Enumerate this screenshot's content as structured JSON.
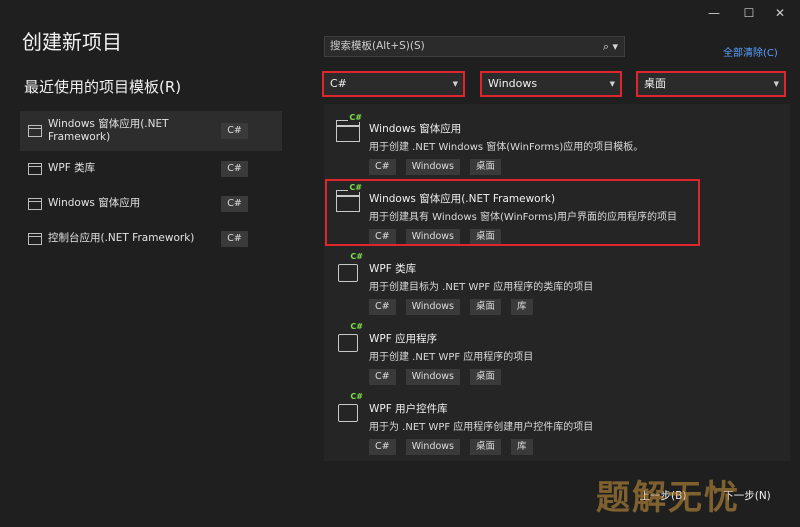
{
  "window": {
    "controls": [
      "—",
      "☐",
      "✕"
    ]
  },
  "page": {
    "title": "创建新项目",
    "recent_title": "最近使用的项目模板(R)"
  },
  "recent": [
    {
      "label": "Windows 窗体应用(.NET Framework)",
      "lang": "C#",
      "selected": true
    },
    {
      "label": "WPF 类库",
      "lang": "C#",
      "selected": false
    },
    {
      "label": "Windows 窗体应用",
      "lang": "C#",
      "selected": false
    },
    {
      "label": "控制台应用(.NET Framework)",
      "lang": "C#",
      "selected": false
    }
  ],
  "search": {
    "placeholder": "搜索模板(Alt+S)(S)",
    "icon": "search-icon"
  },
  "clear_all": "全部清除(C)",
  "filters": {
    "language": "C#",
    "platform": "Windows",
    "project_type": "桌面"
  },
  "templates": [
    {
      "title": "Windows 窗体应用",
      "desc": "用于创建 .NET Windows 窗体(WinForms)应用的项目模板。",
      "tags": [
        "C#",
        "Windows",
        "桌面"
      ],
      "icon": "winforms-icon"
    },
    {
      "title": "Windows 窗体应用(.NET Framework)",
      "desc": "用于创建具有 Windows 窗体(WinForms)用户界面的应用程序的项目",
      "tags": [
        "C#",
        "Windows",
        "桌面"
      ],
      "icon": "winforms-icon"
    },
    {
      "title": "WPF 类库",
      "desc": "用于创建目标为 .NET WPF 应用程序的类库的项目",
      "tags": [
        "C#",
        "Windows",
        "桌面",
        "库"
      ],
      "icon": "wpf-icon"
    },
    {
      "title": "WPF 应用程序",
      "desc": "用于创建 .NET WPF 应用程序的项目",
      "tags": [
        "C#",
        "Windows",
        "桌面"
      ],
      "icon": "wpf-icon"
    },
    {
      "title": "WPF 用户控件库",
      "desc": "用于为 .NET WPF 应用程序创建用户控件库的项目",
      "tags": [
        "C#",
        "Windows",
        "桌面",
        "库"
      ],
      "icon": "wpf-usercontrol-icon"
    }
  ],
  "buttons": {
    "back": "上一步(B)",
    "next": "下一步(N)"
  },
  "watermark": "题解无忧",
  "colors": {
    "highlight": "#e0262d",
    "link": "#5aa0ff",
    "csharp_badge": "#7ee04a"
  }
}
